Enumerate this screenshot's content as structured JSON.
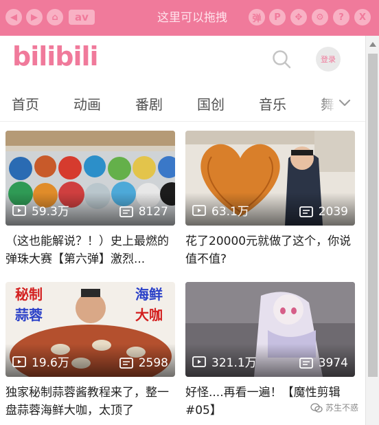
{
  "titlebar": {
    "title": "这里可以拖拽",
    "av_label": "av",
    "right_icons": [
      "弹",
      "P",
      "✥",
      "⚙",
      "?",
      "X"
    ]
  },
  "header": {
    "logo": "bilibili",
    "login_label": "登录"
  },
  "tabs": [
    "首页",
    "动画",
    "番剧",
    "国创",
    "音乐",
    "舞"
  ],
  "videos": [
    {
      "views": "59.3万",
      "danmaku": "8127",
      "title": "（这也能解说？！）史上最燃的弹珠大赛【第六弹】激烈..."
    },
    {
      "views": "63.1万",
      "danmaku": "2039",
      "title": "花了20000元就做了这个，你说值不值?"
    },
    {
      "views": "19.6万",
      "danmaku": "2598",
      "title": "独家秘制蒜蓉酱教程来了，整一盘蒜蓉海鲜大咖，太顶了"
    },
    {
      "views": "321.1万",
      "danmaku": "3974",
      "title": "好怪....再看一遍！【魔性剪辑 #05】"
    }
  ],
  "thumb3_text": {
    "tl": "秘制",
    "tr": "海鲜",
    "bl": "蒜蓉",
    "br": "大咖"
  },
  "watermark": "苏生不惑",
  "colors": {
    "brand": "#f07a9b",
    "tab_text": "#505050"
  }
}
